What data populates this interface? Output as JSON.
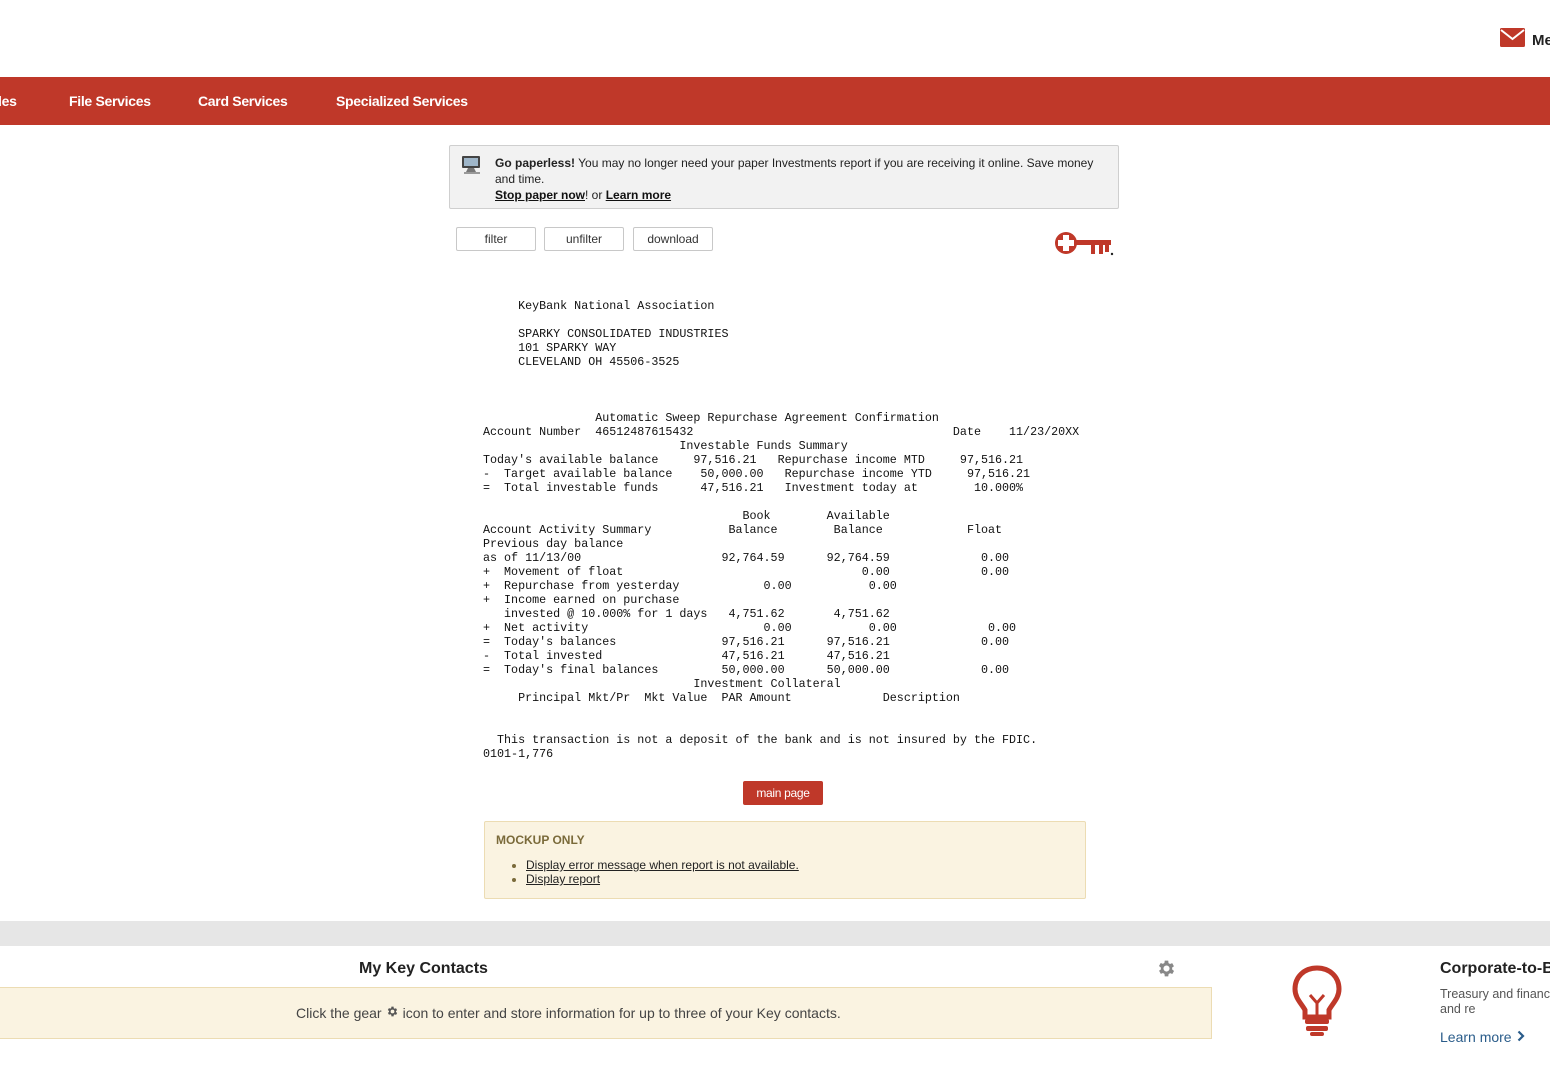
{
  "header": {
    "messages_label": "Me",
    "icons": {
      "messages": "envelope-icon"
    }
  },
  "nav": {
    "items": [
      {
        "label": "les"
      },
      {
        "label": "File Services"
      },
      {
        "label": "Card Services"
      },
      {
        "label": "Specialized Services"
      }
    ],
    "color": "#bf3829"
  },
  "banner": {
    "bold": "Go paperless!",
    "text": " You may no longer need your paper Investments report if you are receiving it online. Save money and time.",
    "stop_link": "Stop paper now",
    "excl": "!",
    "or": " or ",
    "learn_link": "Learn more",
    "icon": "computer-icon"
  },
  "toolbar": {
    "filter": "filter",
    "unfilter": "unfilter",
    "download": "download"
  },
  "logo": "key-logo",
  "report": {
    "lines": [
      "     KeyBank National Association",
      "",
      "     SPARKY CONSOLIDATED INDUSTRIES",
      "     101 SPARKY WAY",
      "     CLEVELAND OH 45506-3525",
      "",
      "",
      "",
      "                Automatic Sweep Repurchase Agreement Confirmation",
      "Account Number  46512487615432                                     Date    11/23/20XX",
      "                            Investable Funds Summary",
      "Today's available balance     97,516.21   Repurchase income MTD     97,516.21",
      "-  Target available balance    50,000.00   Repurchase income YTD     97,516.21",
      "=  Total investable funds      47,516.21   Investment today at        10.000%",
      "",
      "                                     Book        Available",
      "Account Activity Summary           Balance        Balance            Float",
      "Previous day balance",
      "as of 11/13/00                    92,764.59      92,764.59             0.00",
      "+  Movement of float                                  0.00             0.00",
      "+  Repurchase from yesterday            0.00           0.00",
      "+  Income earned on purchase",
      "   invested @ 10.000% for 1 days   4,751.62       4,751.62",
      "+  Net activity                         0.00           0.00             0.00",
      "=  Today's balances               97,516.21      97,516.21             0.00",
      "-  Total invested                 47,516.21      47,516.21",
      "=  Today's final balances         50,000.00      50,000.00             0.00",
      "                              Investment Collateral",
      "     Principal Mkt/Pr  Mkt Value  PAR Amount             Description",
      "",
      "",
      "  This transaction is not a deposit of the bank and is not insured by the FDIC.",
      "0101-1,776"
    ]
  },
  "main_button": "main page",
  "mockup": {
    "heading": "MOCKUP ONLY",
    "items": [
      "Display error message when report is not available.",
      "Display report"
    ]
  },
  "contacts": {
    "title": "My Key Contacts",
    "text_before": "Click the gear",
    "text_after": "icon to enter and store information for up to three of your Key contacts.",
    "icon": "gear-icon"
  },
  "c2b": {
    "title": "Corporate-to-B",
    "desc": "Treasury and financ funds faster and re",
    "learn": "Learn more",
    "icon": "lightbulb-icon"
  }
}
